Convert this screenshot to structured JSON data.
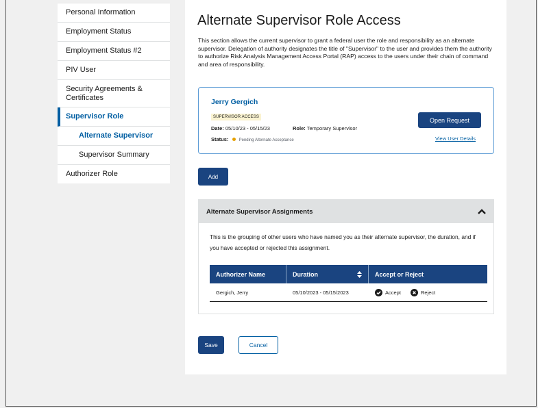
{
  "sidebar": {
    "items": [
      {
        "label": "Personal Information"
      },
      {
        "label": "Employment Status"
      },
      {
        "label": "Employment Status #2"
      },
      {
        "label": "PIV User"
      },
      {
        "label": "Security Agreements & Certificates"
      },
      {
        "label": "Supervisor Role"
      },
      {
        "label": "Alternate Supervisor"
      },
      {
        "label": "Supervisor Summary"
      },
      {
        "label": "Authorizer Role"
      }
    ]
  },
  "main": {
    "title": "Alternate Supervisor Role Access",
    "intro": "This section allows the current supervisor to grant a federal user the role and responsibility as an alternate supervisor. Delegation of authority designates the title of \"Supervisor\" to the user and provides them the authority to authorize Risk Analysis Management Access Portal (RAP) access to the users under their chain of command and area of responsibility.",
    "card": {
      "name": "Jerry Gergich",
      "tag": "SUPERVISOR ACCESS",
      "date_label": "Date:",
      "date_value": "05/10/23 - 05/15/23",
      "role_label": "Role:",
      "role_value": "Temporary Supervisor",
      "status_label": "Status:",
      "status_value": "Pending Alternate Acceptance",
      "status_color": "#e5a000",
      "open_button": "Open Request",
      "view_link": "View User Details"
    },
    "add_button": "Add",
    "accordion": {
      "title": "Alternate Supervisor Assignments",
      "description": "This is the grouping of other users who have named you as their alternate supervisor, the duration, and if you have accepted or rejected this assignment.",
      "table": {
        "headers": [
          "Authorizer Name",
          "Duration",
          "Accept or Reject"
        ],
        "rows": [
          {
            "name": "Gergich, Jerry",
            "duration": "05/10/2023 - 05/15/2023",
            "accept": "Accept",
            "reject": "Reject"
          }
        ]
      }
    },
    "save_button": "Save",
    "cancel_button": "Cancel"
  },
  "colors": {
    "primary": "#1a4480",
    "link": "#005ea2",
    "tag_bg": "#faf3d1"
  }
}
